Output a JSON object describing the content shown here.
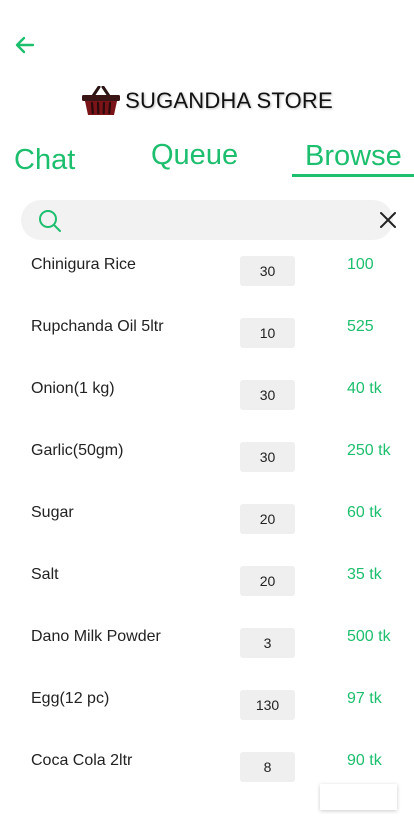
{
  "header": {
    "back_icon": "arrow-left-icon",
    "accent": "#1dbf6e"
  },
  "brand": {
    "logo_icon": "basket-icon",
    "title": "SUGANDHA STORE"
  },
  "tabs": [
    {
      "label": "Chat"
    },
    {
      "label": "Queue"
    },
    {
      "label": "Browse",
      "active": true
    }
  ],
  "search": {
    "value": "",
    "placeholder": "",
    "icon": "search-icon",
    "clear_icon": "close-icon"
  },
  "products": [
    {
      "name": "Chinigura Rice",
      "qty": "30",
      "price": "100"
    },
    {
      "name": "Rupchanda Oil 5ltr",
      "qty": "10",
      "price": "525"
    },
    {
      "name": "Onion(1 kg)",
      "qty": "30",
      "price": "40 tk"
    },
    {
      "name": "Garlic(50gm)",
      "qty": "30",
      "price": "250 tk"
    },
    {
      "name": "Sugar",
      "qty": "20",
      "price": "60 tk"
    },
    {
      "name": "Salt",
      "qty": "20",
      "price": "35 tk"
    },
    {
      "name": "Dano Milk Powder",
      "qty": "3",
      "price": "500 tk"
    },
    {
      "name": "Egg(12 pc)",
      "qty": "130",
      "price": "97 tk"
    },
    {
      "name": "Coca Cola 2ltr",
      "qty": "8",
      "price": "90 tk"
    }
  ]
}
